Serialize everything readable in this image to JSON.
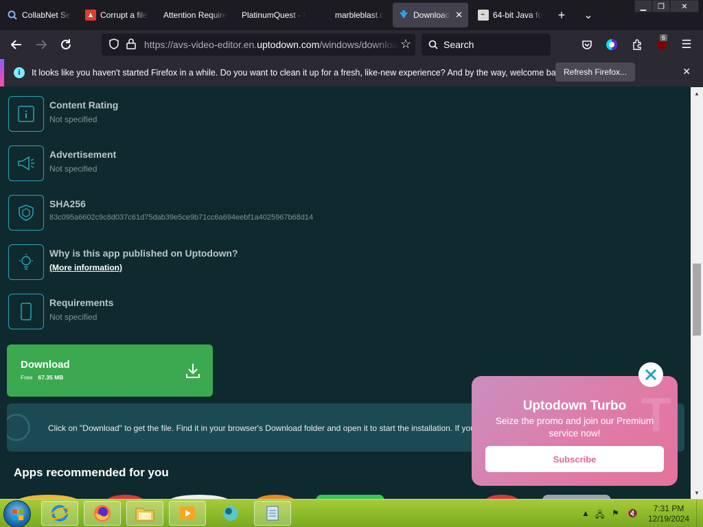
{
  "browser": {
    "tabs": [
      {
        "title": "CollabNet Se",
        "active": false
      },
      {
        "title": "Corrupt a file",
        "active": false
      },
      {
        "title": "Attention Require",
        "active": false
      },
      {
        "title": "PlatinumQuest - I",
        "active": false
      },
      {
        "title": "marbleblast.c",
        "active": false
      },
      {
        "title": "Download",
        "active": true
      },
      {
        "title": "64-bit Java fo",
        "active": false
      }
    ],
    "new_tab_glyph": "+",
    "tab_list_glyph": "⌄",
    "url_prefix": "https://avs-video-editor.en.",
    "url_domain": "uptodown.com",
    "url_path": "/windows/download",
    "search_placeholder": "Search",
    "extension_badge": "6"
  },
  "notification": {
    "message": "It looks like you haven't started Firefox in a while. Do you want to clean it up for a fresh, like-new experience? And by the way, welcome back!",
    "button": "Refresh Firefox..."
  },
  "info_items": [
    {
      "label": "Content Rating",
      "value": "Not specified",
      "icon": "info-icon"
    },
    {
      "label": "Advertisement",
      "value": "Not specified",
      "icon": "megaphone-icon"
    },
    {
      "label": "SHA256",
      "value": "83c095a6602c9c8d037c61d75dab39e5ce9b71cc6a694eebf1a4025967b68d14",
      "icon": "shield-cube-icon"
    },
    {
      "label": "Why is this app published on Uptodown?",
      "value": "(More information)",
      "icon": "lightbulb-icon"
    },
    {
      "label": "Requirements",
      "value": "Not specified",
      "icon": "phone-icon"
    }
  ],
  "download": {
    "label": "Download",
    "price": "Free",
    "size": "67.35 MB"
  },
  "hint_text": "Click on \"Download\" to get the file. Find it in your browser's Download folder and open it to start the installation. If you",
  "recommended_heading": "Apps recommended for you",
  "turbo": {
    "title": "Uptodown Turbo",
    "subtitle": "Seize the promo and join our Premium service now!",
    "button": "Subscribe"
  },
  "taskbar": {
    "time": "7:31 PM",
    "date": "12/19/2024"
  },
  "colors": {
    "page_bg": "#0f2a2e",
    "accent_teal": "#2aa3b5",
    "download_green": "#3ba94f",
    "turbo_pink": "#e07aa6"
  }
}
